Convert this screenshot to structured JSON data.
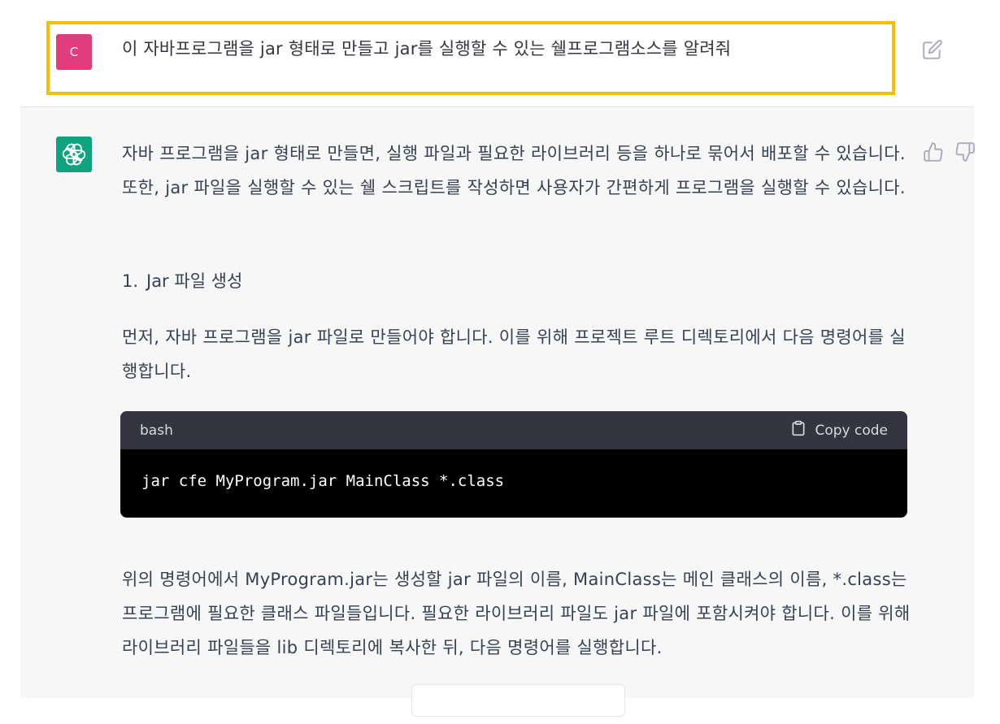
{
  "user_message": {
    "avatar_letter": "C",
    "text": "이 자바프로그램을 jar 형태로 만들고 jar를 실행할 수 있는 쉘프로그램소스를 알려줘"
  },
  "assistant_message": {
    "intro": "자바 프로그램을 jar 형태로 만들면, 실행 파일과 필요한 라이브러리 등을 하나로 묶어서 배포할 수 있습니다. 또한, jar 파일을 실행할 수 있는 쉘 스크립트를 작성하면 사용자가 간편하게 프로그램을 실행할 수 있습니다.",
    "list_item": {
      "number": "1.",
      "text": "Jar 파일 생성"
    },
    "para2": "먼저, 자바 프로그램을 jar 파일로 만들어야 합니다. 이를 위해 프로젝트 루트 디렉토리에서 다음 명령어를 실행합니다.",
    "code": {
      "language": "bash",
      "copy_label": "Copy code",
      "content": "jar cfe MyProgram.jar MainClass *.class"
    },
    "para3": "위의 명령어에서 MyProgram.jar는 생성할 jar 파일의 이름, MainClass는 메인 클래스의 이름, *.class는 프로그램에 필요한 클래스 파일들입니다. 필요한 라이브러리 파일도 jar 파일에 포함시켜야 합니다. 이를 위해 라이브러리 파일들을 lib 디렉토리에 복사한 뒤, 다음 명령어를 실행합니다."
  },
  "icons": {
    "edit": "edit-icon",
    "thumbs_up": "thumbs-up-icon",
    "thumbs_down": "thumbs-down-icon",
    "clipboard": "clipboard-icon",
    "bot_logo": "openai-logo-icon"
  },
  "colors": {
    "highlight": "#f5c000",
    "user_avatar": "#e03d7a",
    "bot_avatar": "#10a37f",
    "assistant_bg": "#f7f7f8",
    "code_header": "#343541",
    "code_bg": "#000000"
  }
}
